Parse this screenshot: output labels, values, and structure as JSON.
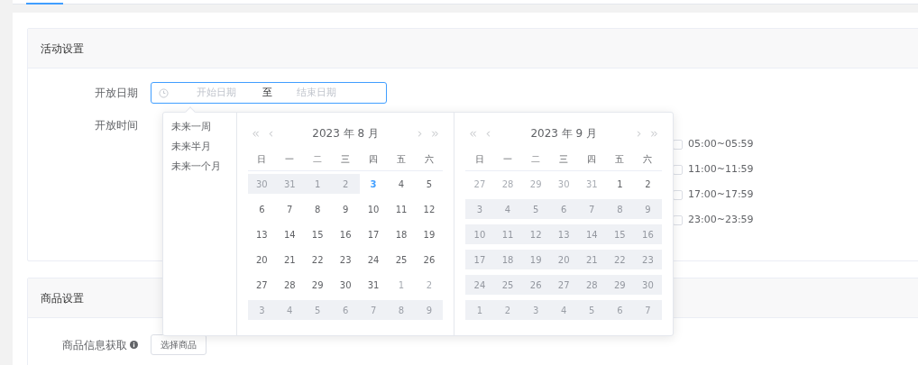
{
  "sections": [
    {
      "title": "活动设置"
    },
    {
      "title": "商品设置"
    }
  ],
  "date_field": {
    "label": "开放日期",
    "start_placeholder": "开始日期",
    "separator": "至",
    "end_placeholder": "结束日期",
    "focused": true
  },
  "time_field": {
    "label": "开放时间",
    "slots": [
      {
        "label": "05:00~05:59",
        "checked": false
      },
      {
        "label": "11:00~11:59",
        "checked": false
      },
      {
        "label": "17:00~17:59",
        "checked": false
      },
      {
        "label": "23:00~23:59",
        "checked": false
      }
    ]
  },
  "shortcuts": [
    "未来一周",
    "未来半月",
    "未来一个月"
  ],
  "calendars": [
    {
      "title": "2023 年 8 月",
      "weekdays": [
        "日",
        "一",
        "二",
        "三",
        "四",
        "五",
        "六"
      ],
      "days": [
        {
          "label": "30",
          "kind": "prev",
          "disabled": true,
          "today": false
        },
        {
          "label": "31",
          "kind": "prev",
          "disabled": true,
          "today": false
        },
        {
          "label": "1",
          "kind": "current",
          "disabled": true,
          "today": false
        },
        {
          "label": "2",
          "kind": "current",
          "disabled": true,
          "today": false
        },
        {
          "label": "3",
          "kind": "current",
          "disabled": false,
          "today": true
        },
        {
          "label": "4",
          "kind": "current",
          "disabled": false,
          "today": false
        },
        {
          "label": "5",
          "kind": "current",
          "disabled": false,
          "today": false
        },
        {
          "label": "6",
          "kind": "current",
          "disabled": false,
          "today": false
        },
        {
          "label": "7",
          "kind": "current",
          "disabled": false,
          "today": false
        },
        {
          "label": "8",
          "kind": "current",
          "disabled": false,
          "today": false
        },
        {
          "label": "9",
          "kind": "current",
          "disabled": false,
          "today": false
        },
        {
          "label": "10",
          "kind": "current",
          "disabled": false,
          "today": false
        },
        {
          "label": "11",
          "kind": "current",
          "disabled": false,
          "today": false
        },
        {
          "label": "12",
          "kind": "current",
          "disabled": false,
          "today": false
        },
        {
          "label": "13",
          "kind": "current",
          "disabled": false,
          "today": false
        },
        {
          "label": "14",
          "kind": "current",
          "disabled": false,
          "today": false
        },
        {
          "label": "15",
          "kind": "current",
          "disabled": false,
          "today": false
        },
        {
          "label": "16",
          "kind": "current",
          "disabled": false,
          "today": false
        },
        {
          "label": "17",
          "kind": "current",
          "disabled": false,
          "today": false
        },
        {
          "label": "18",
          "kind": "current",
          "disabled": false,
          "today": false
        },
        {
          "label": "19",
          "kind": "current",
          "disabled": false,
          "today": false
        },
        {
          "label": "20",
          "kind": "current",
          "disabled": false,
          "today": false
        },
        {
          "label": "21",
          "kind": "current",
          "disabled": false,
          "today": false
        },
        {
          "label": "22",
          "kind": "current",
          "disabled": false,
          "today": false
        },
        {
          "label": "23",
          "kind": "current",
          "disabled": false,
          "today": false
        },
        {
          "label": "24",
          "kind": "current",
          "disabled": false,
          "today": false
        },
        {
          "label": "25",
          "kind": "current",
          "disabled": false,
          "today": false
        },
        {
          "label": "26",
          "kind": "current",
          "disabled": false,
          "today": false
        },
        {
          "label": "27",
          "kind": "current",
          "disabled": false,
          "today": false
        },
        {
          "label": "28",
          "kind": "current",
          "disabled": false,
          "today": false
        },
        {
          "label": "29",
          "kind": "current",
          "disabled": false,
          "today": false
        },
        {
          "label": "30",
          "kind": "current",
          "disabled": false,
          "today": false
        },
        {
          "label": "31",
          "kind": "current",
          "disabled": false,
          "today": false
        },
        {
          "label": "1",
          "kind": "next",
          "disabled": false,
          "today": false
        },
        {
          "label": "2",
          "kind": "next",
          "disabled": false,
          "today": false
        },
        {
          "label": "3",
          "kind": "next",
          "disabled": true,
          "today": false
        },
        {
          "label": "4",
          "kind": "next",
          "disabled": true,
          "today": false
        },
        {
          "label": "5",
          "kind": "next",
          "disabled": true,
          "today": false
        },
        {
          "label": "6",
          "kind": "next",
          "disabled": true,
          "today": false
        },
        {
          "label": "7",
          "kind": "next",
          "disabled": true,
          "today": false
        },
        {
          "label": "8",
          "kind": "next",
          "disabled": true,
          "today": false
        },
        {
          "label": "9",
          "kind": "next",
          "disabled": true,
          "today": false
        }
      ]
    },
    {
      "title": "2023 年 9 月",
      "weekdays": [
        "日",
        "一",
        "二",
        "三",
        "四",
        "五",
        "六"
      ],
      "days": [
        {
          "label": "27",
          "kind": "prev",
          "disabled": false,
          "today": false
        },
        {
          "label": "28",
          "kind": "prev",
          "disabled": false,
          "today": false
        },
        {
          "label": "29",
          "kind": "prev",
          "disabled": false,
          "today": false
        },
        {
          "label": "30",
          "kind": "prev",
          "disabled": false,
          "today": false
        },
        {
          "label": "31",
          "kind": "prev",
          "disabled": false,
          "today": false
        },
        {
          "label": "1",
          "kind": "current",
          "disabled": false,
          "today": false
        },
        {
          "label": "2",
          "kind": "current",
          "disabled": false,
          "today": false
        },
        {
          "label": "3",
          "kind": "current",
          "disabled": true,
          "today": false
        },
        {
          "label": "4",
          "kind": "current",
          "disabled": true,
          "today": false
        },
        {
          "label": "5",
          "kind": "current",
          "disabled": true,
          "today": false
        },
        {
          "label": "6",
          "kind": "current",
          "disabled": true,
          "today": false
        },
        {
          "label": "7",
          "kind": "current",
          "disabled": true,
          "today": false
        },
        {
          "label": "8",
          "kind": "current",
          "disabled": true,
          "today": false
        },
        {
          "label": "9",
          "kind": "current",
          "disabled": true,
          "today": false
        },
        {
          "label": "10",
          "kind": "current",
          "disabled": true,
          "today": false
        },
        {
          "label": "11",
          "kind": "current",
          "disabled": true,
          "today": false
        },
        {
          "label": "12",
          "kind": "current",
          "disabled": true,
          "today": false
        },
        {
          "label": "13",
          "kind": "current",
          "disabled": true,
          "today": false
        },
        {
          "label": "14",
          "kind": "current",
          "disabled": true,
          "today": false
        },
        {
          "label": "15",
          "kind": "current",
          "disabled": true,
          "today": false
        },
        {
          "label": "16",
          "kind": "current",
          "disabled": true,
          "today": false
        },
        {
          "label": "17",
          "kind": "current",
          "disabled": true,
          "today": false
        },
        {
          "label": "18",
          "kind": "current",
          "disabled": true,
          "today": false
        },
        {
          "label": "19",
          "kind": "current",
          "disabled": true,
          "today": false
        },
        {
          "label": "20",
          "kind": "current",
          "disabled": true,
          "today": false
        },
        {
          "label": "21",
          "kind": "current",
          "disabled": true,
          "today": false
        },
        {
          "label": "22",
          "kind": "current",
          "disabled": true,
          "today": false
        },
        {
          "label": "23",
          "kind": "current",
          "disabled": true,
          "today": false
        },
        {
          "label": "24",
          "kind": "current",
          "disabled": true,
          "today": false
        },
        {
          "label": "25",
          "kind": "current",
          "disabled": true,
          "today": false
        },
        {
          "label": "26",
          "kind": "current",
          "disabled": true,
          "today": false
        },
        {
          "label": "27",
          "kind": "current",
          "disabled": true,
          "today": false
        },
        {
          "label": "28",
          "kind": "current",
          "disabled": true,
          "today": false
        },
        {
          "label": "29",
          "kind": "current",
          "disabled": true,
          "today": false
        },
        {
          "label": "30",
          "kind": "current",
          "disabled": true,
          "today": false
        },
        {
          "label": "1",
          "kind": "next",
          "disabled": true,
          "today": false
        },
        {
          "label": "2",
          "kind": "next",
          "disabled": true,
          "today": false
        },
        {
          "label": "3",
          "kind": "next",
          "disabled": true,
          "today": false
        },
        {
          "label": "4",
          "kind": "next",
          "disabled": true,
          "today": false
        },
        {
          "label": "5",
          "kind": "next",
          "disabled": true,
          "today": false
        },
        {
          "label": "6",
          "kind": "next",
          "disabled": true,
          "today": false
        },
        {
          "label": "7",
          "kind": "next",
          "disabled": true,
          "today": false
        }
      ]
    }
  ],
  "product_field": {
    "label": "商品信息获取",
    "button": "选择商品"
  }
}
